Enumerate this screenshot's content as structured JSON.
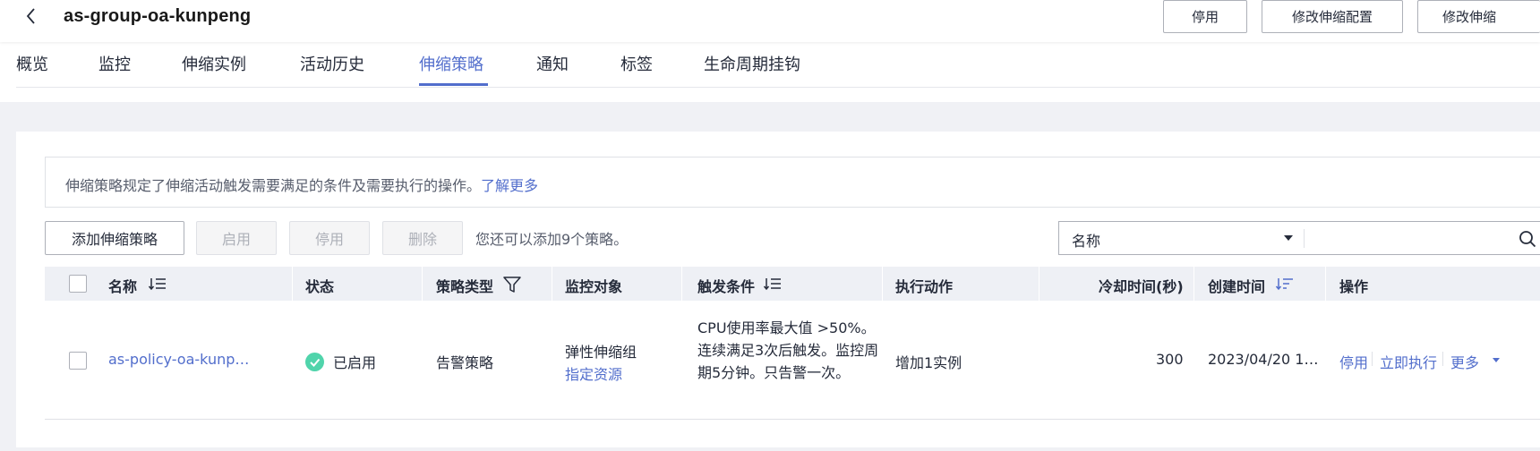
{
  "header": {
    "title": "as-group-oa-kunpeng",
    "buttons": {
      "disable": "停用",
      "modify_config": "修改伸缩配置",
      "modify_group": "修改伸缩"
    }
  },
  "tabs": [
    {
      "label": "概览"
    },
    {
      "label": "监控"
    },
    {
      "label": "伸缩实例"
    },
    {
      "label": "活动历史"
    },
    {
      "label": "伸缩策略",
      "active": true
    },
    {
      "label": "通知"
    },
    {
      "label": "标签"
    },
    {
      "label": "生命周期挂钩"
    }
  ],
  "notice": {
    "text": "伸缩策略规定了伸缩活动触发需要满足的条件及需要执行的操作。",
    "link": "了解更多"
  },
  "toolbar": {
    "add": "添加伸缩策略",
    "enable": "启用",
    "disable": "停用",
    "delete": "删除",
    "quota": "您还可以添加9个策略。"
  },
  "search": {
    "field": "名称",
    "value": ""
  },
  "table": {
    "columns": {
      "name": "名称",
      "status": "状态",
      "type": "策略类型",
      "monitor": "监控对象",
      "trigger": "触发条件",
      "action": "执行动作",
      "cooldown": "冷却时间(秒)",
      "created": "创建时间",
      "ops": "操作"
    },
    "rows": [
      {
        "name": "as-policy-oa-kunp…",
        "status": "已启用",
        "type": "告警策略",
        "monitor": "弹性伸缩组",
        "monitor_link": "指定资源",
        "trigger": "CPU使用率最大值 >50%。连续满足3次后触发。监控周期5分钟。只告警一次。",
        "action": "增加1实例",
        "cooldown": "300",
        "created": "2023/04/20 1…",
        "ops": {
          "disable": "停用",
          "execute": "立即执行",
          "more": "更多"
        }
      }
    ]
  },
  "colors": {
    "accent": "#526ecc",
    "status_ok": "#50d4ab",
    "header_bg": "#eef0f5"
  }
}
